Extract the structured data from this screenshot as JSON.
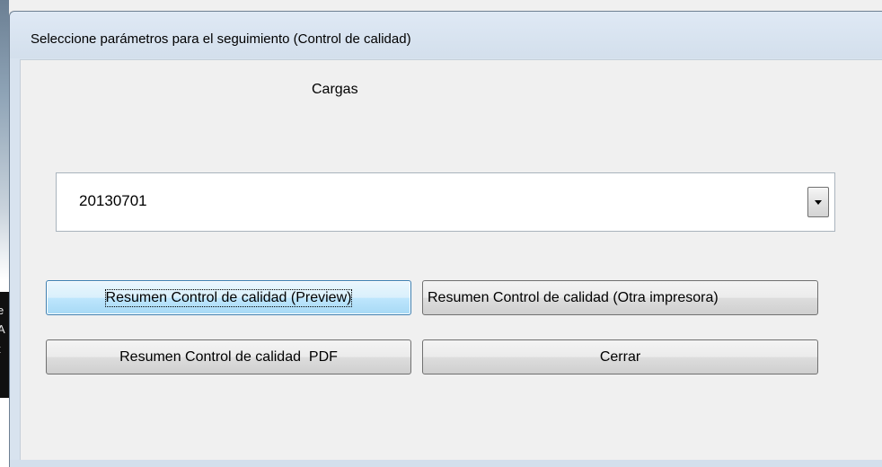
{
  "window": {
    "title": "Seleccione parámetros para el seguimiento (Control de calidad)"
  },
  "form": {
    "cargas_label": "Cargas",
    "cargas_combo": {
      "value": "20130701"
    }
  },
  "buttons": {
    "preview": "Resumen Control de calidad (Preview)",
    "otra_impresora": "Resumen Control de calidad (Otra impresora)",
    "pdf": "Resumen Control de calidad  PDF",
    "cerrar": "Cerrar"
  },
  "background": {
    "edge_glyphs": [
      "e",
      "A",
      "t"
    ]
  }
}
